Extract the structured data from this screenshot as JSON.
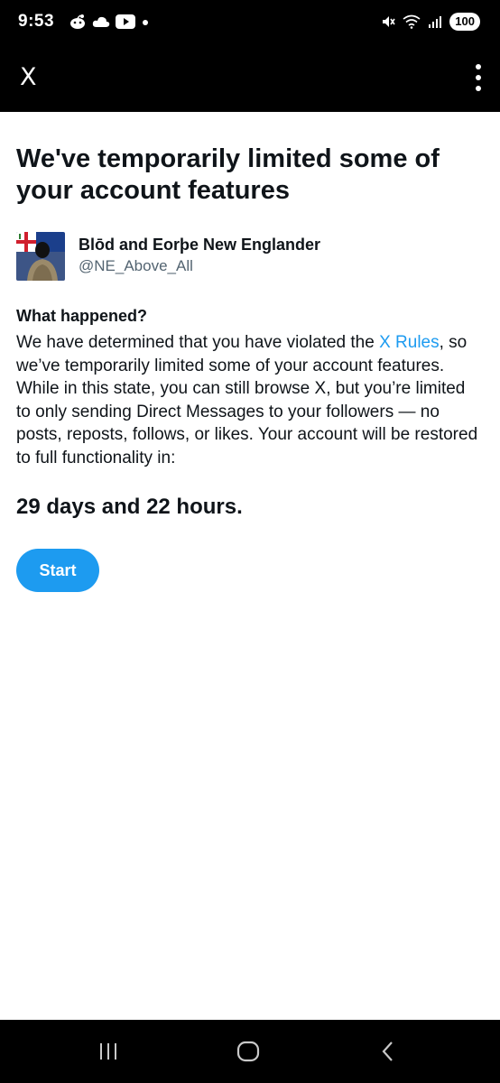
{
  "status_bar": {
    "time": "9:53",
    "battery": "100"
  },
  "app_bar": {
    "title": "X"
  },
  "main": {
    "heading": "We've temporarily limited some of your account features",
    "account": {
      "name": "Blōd and Eorþe New Englander",
      "handle": "@NE_Above_All"
    },
    "what_happened_title": "What happened?",
    "body_before_link": "We have determined that you have violated the ",
    "body_link": "X Rules",
    "body_after_link": ", so we’ve temporarily limited some of your account features. While in this state, you can still browse X, but you’re limited to only sending Direct Messages to your followers — no posts, reposts, follows, or likes. Your account will be restored to full functionality in:",
    "duration": "29 days and 22 hours.",
    "start_label": "Start"
  },
  "colors": {
    "accent": "#1d9bf0",
    "text_primary": "#0f1419",
    "text_secondary": "#536471",
    "bar_background": "#000000"
  },
  "icons": [
    "reddit-icon",
    "cloud-icon",
    "youtube-icon",
    "notification-dot-icon",
    "mute-icon",
    "wifi-icon",
    "signal-icon",
    "more-vertical-icon",
    "recents-icon",
    "home-icon",
    "back-icon"
  ]
}
